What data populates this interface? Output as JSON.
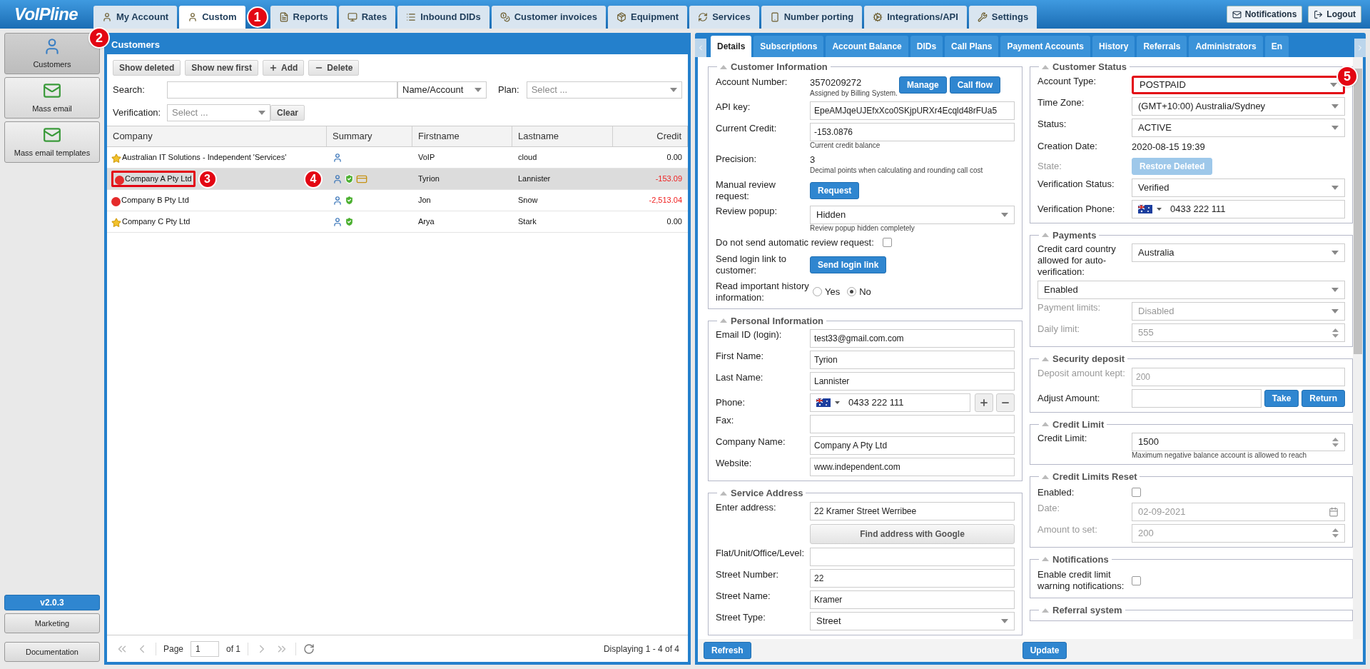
{
  "topbar": {
    "logo": "VoIPline",
    "tabs": [
      {
        "label": "My Account",
        "selected": false
      },
      {
        "label": "Custom",
        "selected": true,
        "marker": "1"
      },
      {
        "label": "Reports",
        "selected": false
      },
      {
        "label": "Rates",
        "selected": false
      },
      {
        "label": "Inbound DIDs",
        "selected": false
      },
      {
        "label": "Customer invoices",
        "selected": false
      },
      {
        "label": "Equipment",
        "selected": false
      },
      {
        "label": "Services",
        "selected": false
      },
      {
        "label": "Number porting",
        "selected": false
      },
      {
        "label": "Integrations/API",
        "selected": false
      },
      {
        "label": "Settings",
        "selected": false
      }
    ],
    "actions": [
      "Notifications",
      "Logout"
    ]
  },
  "sidebar": {
    "items": [
      {
        "label": "Customers",
        "selected": true,
        "marker": "2"
      },
      {
        "label": "Mass email",
        "selected": false
      },
      {
        "label": "Mass email templates",
        "selected": false
      }
    ],
    "version": "v2.0.3",
    "links": [
      "Marketing",
      "Documentation"
    ]
  },
  "customers": {
    "title": "Customers",
    "toolbar": [
      "Show deleted",
      "Show new first",
      "Add",
      "Delete"
    ],
    "search_label": "Search:",
    "search_by": "Name/Account",
    "plan_label": "Plan:",
    "plan_placeholder": "Select ...",
    "verification_label": "Verification:",
    "verification_placeholder": "Select ...",
    "clear": "Clear",
    "columns": [
      "Company",
      "Summary",
      "Firstname",
      "Lastname",
      "Credit"
    ],
    "rows": [
      {
        "kind": "star",
        "company": "Australian IT Solutions - Independent 'Services'",
        "summary": [
          {
            "kind": "user"
          }
        ],
        "firstname": "VoIP",
        "lastname": "cloud",
        "credit": "0.00",
        "negative": false,
        "selected": false
      },
      {
        "kind": "red",
        "company": "Company A Pty Ltd",
        "highlight": true,
        "marker": "3",
        "summary_marker": "4",
        "summary": [
          {
            "kind": "user"
          },
          {
            "kind": "shield"
          },
          {
            "kind": "card"
          }
        ],
        "firstname": "Tyrion",
        "lastname": "Lannister",
        "credit": "-153.09",
        "negative": true,
        "selected": true
      },
      {
        "kind": "red",
        "company": "Company B Pty Ltd",
        "summary": [
          {
            "kind": "user"
          },
          {
            "kind": "shield"
          }
        ],
        "firstname": "Jon",
        "lastname": "Snow",
        "credit": "-2,513.04",
        "negative": true,
        "selected": false
      },
      {
        "kind": "star",
        "company": "Company C Pty Ltd",
        "summary": [
          {
            "kind": "user"
          },
          {
            "kind": "shield"
          }
        ],
        "firstname": "Arya",
        "lastname": "Stark",
        "credit": "0.00",
        "negative": false,
        "selected": false
      }
    ],
    "pager": {
      "page_label": "Page",
      "page": "1",
      "of": "of 1",
      "display": "Displaying 1 - 4 of 4"
    }
  },
  "details": {
    "tabs": [
      {
        "label": "Details",
        "selected": true
      },
      {
        "label": "Subscriptions",
        "selected": false
      },
      {
        "label": "Account Balance",
        "selected": false
      },
      {
        "label": "DIDs",
        "selected": false
      },
      {
        "label": "Call Plans",
        "selected": false
      },
      {
        "label": "Payment Accounts",
        "selected": false
      },
      {
        "label": "History",
        "selected": false
      },
      {
        "label": "Referrals",
        "selected": false
      },
      {
        "label": "Administrators",
        "selected": false
      },
      {
        "label": "En",
        "selected": false
      }
    ],
    "left": [
      {
        "title": "Customer Information",
        "rows": [
          {
            "kind": "text",
            "label": "Account Number:",
            "value": "3570209272",
            "hint": "Assigned by Billing System.",
            "buttons": [
              "Manage",
              "Call flow"
            ]
          },
          {
            "kind": "input",
            "label": "API key:",
            "value": "EpeAMJqeUJEfxXco0SKjpURXr4Ecqld48rFUa5"
          },
          {
            "kind": "input",
            "label": "Current Credit:",
            "value": "-153.0876",
            "hint": "Current credit balance"
          },
          {
            "kind": "text",
            "label": "Precision:",
            "value": "3",
            "hint": "Decimal points when calculating and rounding call cost"
          },
          {
            "kind": "button",
            "label": "Manual review request:",
            "value": "Request"
          },
          {
            "kind": "select",
            "label": "Review popup:",
            "value": "Hidden",
            "hint": "Review popup hidden completely"
          },
          {
            "kind": "checkbox_inline",
            "label": "Do not send automatic review request:",
            "checked": false
          },
          {
            "kind": "button",
            "label": "Send login link to customer:",
            "value": "Send login link"
          },
          {
            "kind": "radio",
            "label": "Read important history information:",
            "options": [
              {
                "label": "Yes",
                "selected": false
              },
              {
                "label": "No",
                "selected": true
              }
            ]
          }
        ]
      },
      {
        "title": "Personal Information",
        "rows": [
          {
            "kind": "input",
            "label": "Email ID (login):",
            "value": "test33@gmail.com.com"
          },
          {
            "kind": "input",
            "label": "First Name:",
            "value": "Tyrion"
          },
          {
            "kind": "input",
            "label": "Last Name:",
            "value": "Lannister"
          },
          {
            "kind": "phone",
            "label": "Phone:",
            "value": "0433 222 111",
            "add_remove": true
          },
          {
            "kind": "input",
            "label": "Fax:"
          },
          {
            "kind": "input",
            "label": "Company Name:",
            "value": "Company A Pty Ltd"
          },
          {
            "kind": "input",
            "label": "Website:",
            "value": "www.independent.com"
          }
        ]
      },
      {
        "title": "Service Address",
        "rows": [
          {
            "kind": "input",
            "label": "Enter address:",
            "value": "22 Kramer Street Werribee"
          },
          {
            "kind": "wide_button",
            "value": "Find address with Google"
          },
          {
            "kind": "input",
            "label": "Flat/Unit/Office/Level:"
          },
          {
            "kind": "input",
            "label": "Street Number:",
            "value": "22"
          },
          {
            "kind": "input",
            "label": "Street Name:",
            "value": "Kramer"
          },
          {
            "kind": "select",
            "label": "Street Type:",
            "value": "Street"
          }
        ]
      }
    ],
    "right": [
      {
        "title": "Customer Status",
        "rows": [
          {
            "kind": "select",
            "label": "Account Type:",
            "value": "POSTPAID",
            "highlight": true,
            "marker": "5"
          },
          {
            "kind": "select",
            "label": "Time Zone:",
            "value": "(GMT+10:00) Australia/Sydney"
          },
          {
            "kind": "select",
            "label": "Status:",
            "value": "ACTIVE"
          },
          {
            "kind": "text",
            "label": "Creation Date:",
            "value": "2020-08-15 19:39"
          },
          {
            "kind": "button",
            "label": "State:",
            "value": "Restore Deleted",
            "disabled": true
          },
          {
            "kind": "select",
            "label": "Verification Status:",
            "value": "Verified"
          },
          {
            "kind": "phone",
            "label": "Verification Phone:",
            "value": "0433 222 111"
          }
        ]
      },
      {
        "title": "Payments",
        "rows": [
          {
            "kind": "select",
            "label": "Credit card country allowed for auto-verification:",
            "value": "Australia"
          },
          {
            "kind": "select_full",
            "value": "Enabled"
          },
          {
            "kind": "select",
            "label": "Payment limits:",
            "value": "Disabled",
            "disabled": true
          },
          {
            "kind": "spin",
            "label": "Daily limit:",
            "value": "555",
            "disabled": true
          }
        ]
      },
      {
        "title": "Security deposit",
        "rows": [
          {
            "kind": "input",
            "label": "Deposit amount kept:",
            "value": "200",
            "disabled": true
          },
          {
            "kind": "input_buttons",
            "label": "Adjust Amount:",
            "buttons": [
              "Take",
              "Return"
            ]
          }
        ]
      },
      {
        "title": "Credit Limit",
        "rows": [
          {
            "kind": "spin",
            "label": "Credit Limit:",
            "value": "1500",
            "hint": "Maximum negative balance account is allowed to reach"
          }
        ]
      },
      {
        "title": "Credit Limits Reset",
        "rows": [
          {
            "kind": "checkbox",
            "label": "Enabled:",
            "checked": false
          },
          {
            "kind": "date",
            "label": "Date:",
            "value": "02-09-2021",
            "disabled": true
          },
          {
            "kind": "spin",
            "label": "Amount to set:",
            "value": "200",
            "disabled": true
          }
        ]
      },
      {
        "title": "Notifications",
        "rows": [
          {
            "kind": "checkbox",
            "label": "Enable credit limit warning notifications:",
            "checked": false
          }
        ]
      },
      {
        "title": "Referral system"
      }
    ],
    "footer": [
      "Refresh",
      "Update"
    ]
  }
}
